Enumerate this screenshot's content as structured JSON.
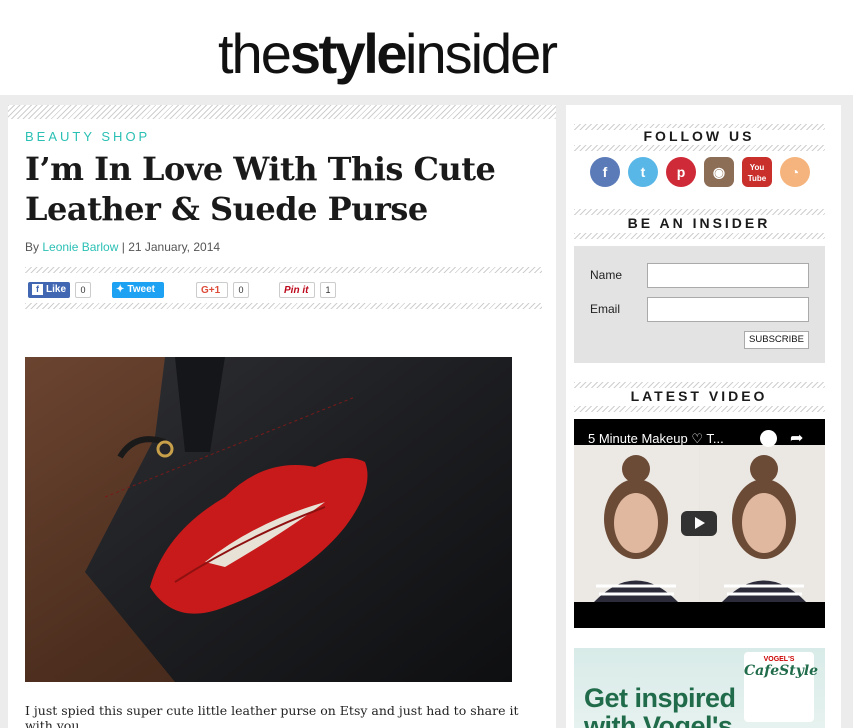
{
  "header": {
    "logo_the": "the",
    "logo_style": "style",
    "logo_insider": "insider"
  },
  "article": {
    "category": "BEAUTY SHOP",
    "title_line1": "I’m In Love With This Cute",
    "title_line2": "Leather & Suede Purse",
    "byline_prefix": "By ",
    "author": "Leonie Barlow",
    "date_sep": " | ",
    "date": "21 January, 2014",
    "body": "I just spied this super cute little leather purse on Etsy and just had to share it with you."
  },
  "share": {
    "facebook_label": "Like",
    "facebook_count": "0",
    "twitter_label": "Tweet",
    "gplus_label": "G+1",
    "gplus_count": "0",
    "pinterest_label": "Pin it",
    "pinterest_count": "1"
  },
  "sidebar": {
    "follow_heading": "FOLLOW US",
    "social_icons": [
      "facebook-icon",
      "twitter-icon",
      "pinterest-icon",
      "instagram-icon",
      "youtube-icon",
      "rss-icon"
    ],
    "youtube_text": "You Tube",
    "insider_heading": "BE AN INSIDER",
    "name_label": "Name",
    "email_label": "Email",
    "subscribe_label": "SUBSCRIBE",
    "video_heading": "LATEST VIDEO",
    "video_title": "5 Minute Makeup ♡ T...",
    "ad_brand": "VOGEL'S",
    "ad_product": "CafeStyle",
    "ad_text_line1": "Get inspired",
    "ad_text_line2": "with Vogel's"
  },
  "colors": {
    "accent": "#2bc0b4",
    "facebook": "#4267b2",
    "twitter": "#1da1f2"
  }
}
